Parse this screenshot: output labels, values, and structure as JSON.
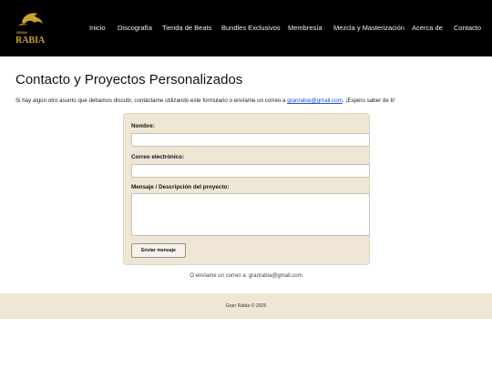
{
  "brand": {
    "logo_top": "GRAN",
    "logo_main": "RABIA",
    "colors": {
      "gold": "#c9a227",
      "header_bg": "#000000",
      "cream": "#efe6d6",
      "link": "#1a4fd8"
    }
  },
  "nav": {
    "items": [
      {
        "label": "Inicio"
      },
      {
        "label": "Discografía"
      },
      {
        "label": "Tienda de Beats"
      },
      {
        "label": "Bundles Exclusivos"
      },
      {
        "label": "Membresía"
      },
      {
        "label": "Mezcla y Masterización"
      },
      {
        "label": "Acerca de"
      },
      {
        "label": "Contacto"
      }
    ]
  },
  "page": {
    "title": "Contacto y Proyectos Personalizados",
    "intro_before": "Si hay algún otro asunto que debamos discutir, contáctame utilizando este formulario o envíame un correo a ",
    "intro_email": "granrabia@gmail.com",
    "intro_after": ". ¡Espero saber de ti!"
  },
  "form": {
    "name_label": "Nombre:",
    "name_value": "",
    "email_label": "Correo electrónico:",
    "email_value": "",
    "message_label": "Mensaje / Descripción del proyecto:",
    "message_value": "",
    "submit_label": "Enviar mensaje"
  },
  "alt_email": "O envíame un correo a: granrabia@gmail.com",
  "footer": {
    "text": "Gran Rabia © 2025"
  }
}
